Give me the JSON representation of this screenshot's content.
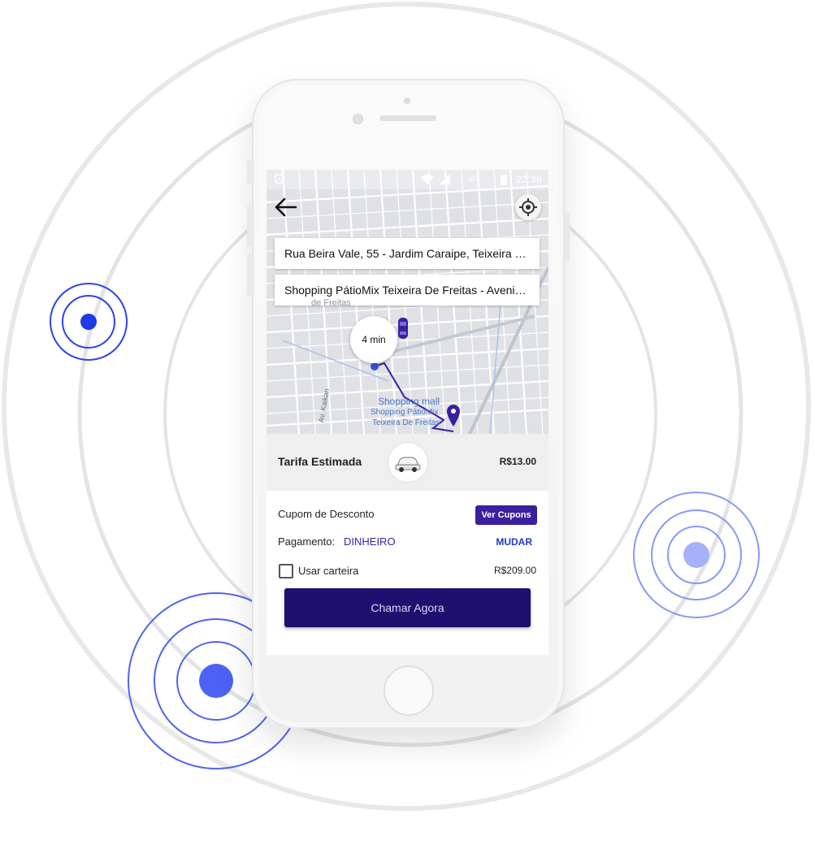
{
  "status_bar": {
    "network": "4G",
    "time": "22:38"
  },
  "map": {
    "origin_address": "Rua Beira Vale, 55 - Jardim Caraipe, Teixeira de...",
    "destination_address": "Shopping PátioMix Teixeira De Freitas - Avenida...",
    "eta": "4 min",
    "place_category": "Shopping mall",
    "place_name_line1": "Shopping PátioMix",
    "place_name_line2": "Teixeira De Freitas",
    "street_label": "Av. Kaikan",
    "district_label": "de Freitas"
  },
  "fare": {
    "label": "Tarifa Estimada",
    "price": "R$13.00"
  },
  "coupon": {
    "label": "Cupom de Desconto",
    "button": "Ver Cupons"
  },
  "payment": {
    "label": "Pagamento:",
    "value": "DINHEIRO",
    "change": "MUDAR"
  },
  "wallet": {
    "label": "Usar carteira",
    "balance": "R$209.00",
    "checked": false
  },
  "cta": {
    "label": "Chamar Agora"
  },
  "colors": {
    "primary": "#1f0f6e",
    "accent": "#3a1f9e",
    "link": "#2435c4",
    "pulse": "#3b4ef0"
  },
  "icons": [
    "back-arrow-icon",
    "gps-target-icon",
    "car-icon",
    "destination-pin-icon",
    "wifi-icon",
    "signal-icon",
    "battery-icon"
  ]
}
